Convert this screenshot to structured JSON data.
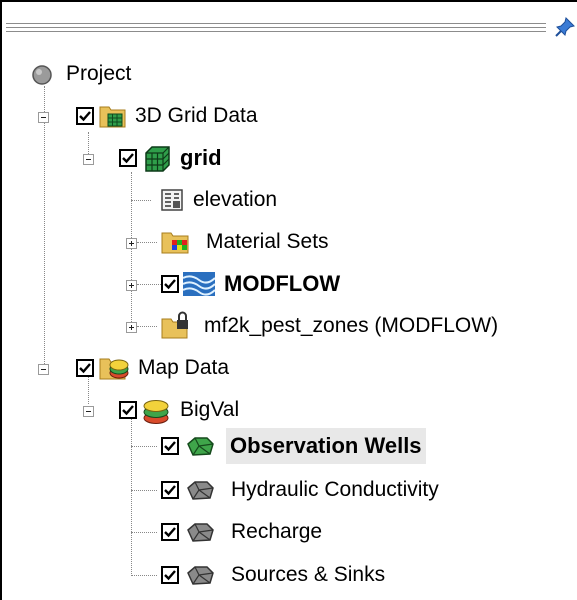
{
  "panel": {
    "pin_icon": "pushpin-icon"
  },
  "tree": {
    "project": {
      "label": "Project",
      "icon": "gray-circle-icon"
    },
    "grid_data": {
      "label": "3D Grid Data",
      "checked": true,
      "icon": "grid-folder-icon"
    },
    "grid": {
      "label": "grid",
      "checked": true,
      "icon": "grid-cube-icon"
    },
    "elevation": {
      "label": "elevation",
      "icon": "dataset-icon"
    },
    "material_sets": {
      "label": "Material Sets",
      "icon": "material-folder-icon"
    },
    "modflow": {
      "label": "MODFLOW",
      "checked": true,
      "icon": "modflow-icon"
    },
    "pest_zones": {
      "label": "mf2k_pest_zones (MODFLOW)",
      "icon": "locked-folder-icon"
    },
    "map_data": {
      "label": "Map Data",
      "checked": true,
      "icon": "map-folder-icon"
    },
    "bigval": {
      "label": "BigVal",
      "checked": true,
      "icon": "map-layers-icon"
    },
    "observation_wells": {
      "label": "Observation Wells",
      "checked": true,
      "selected": true,
      "icon": "coverage-active-icon"
    },
    "hydraulic_conductivity": {
      "label": "Hydraulic Conductivity",
      "checked": true,
      "icon": "coverage-icon"
    },
    "recharge": {
      "label": "Recharge",
      "checked": true,
      "icon": "coverage-icon"
    },
    "sources_sinks": {
      "label": "Sources & Sinks",
      "checked": true,
      "icon": "coverage-icon"
    }
  },
  "colors": {
    "coverage_active": "#3fa54a",
    "coverage_inactive": "#8a8a8a",
    "folder": "#e8c15a",
    "selection": "#e8e8e8"
  }
}
